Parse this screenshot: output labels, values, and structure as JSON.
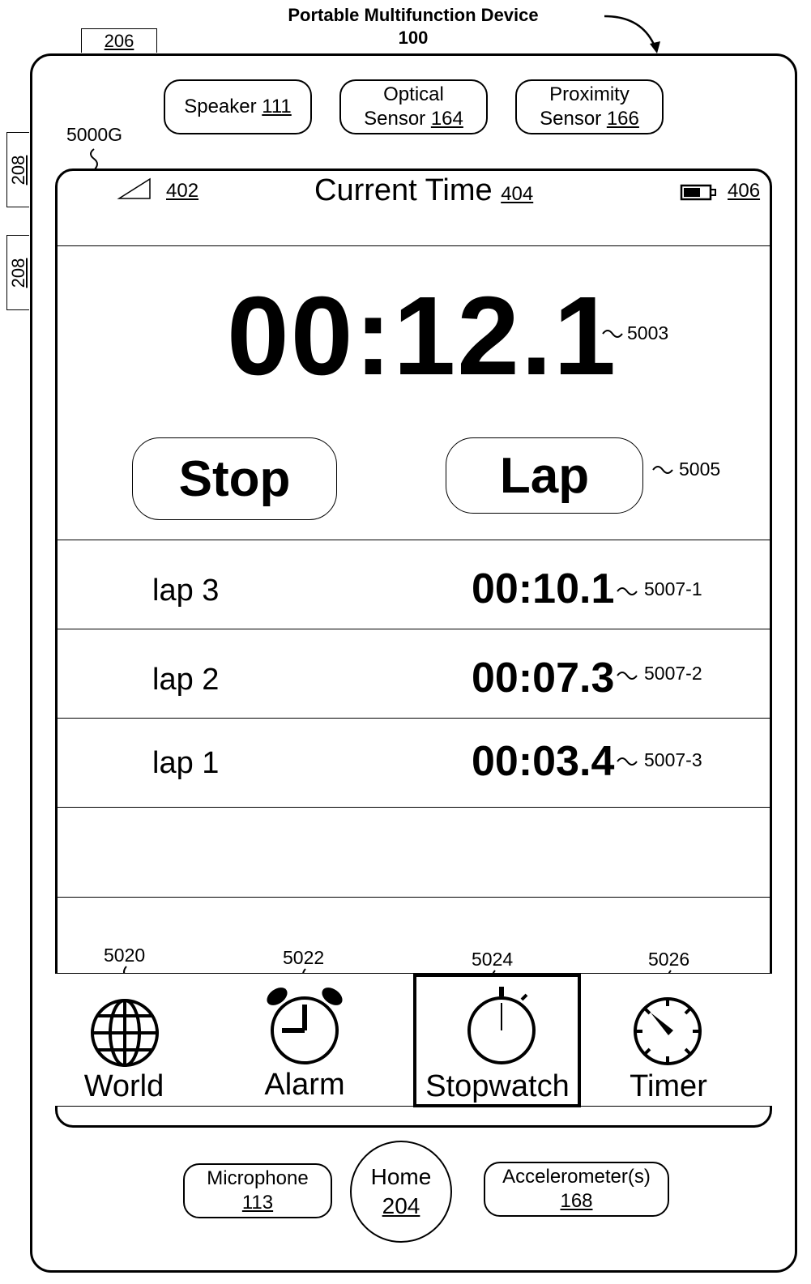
{
  "figure": {
    "title_line1": "Portable Multifunction Device",
    "title_line2": "100",
    "ref_206": "206",
    "ref_208_a": "208",
    "ref_208_b": "208",
    "screen_ref": "5000G"
  },
  "sensors": {
    "speaker_label": "Speaker",
    "speaker_ref": "111",
    "optical_label": "Optical",
    "optical_label2": "Sensor",
    "optical_ref": "164",
    "proximity_label": "Proximity",
    "proximity_label2": "Sensor",
    "proximity_ref": "166"
  },
  "status_bar": {
    "signal_ref": "402",
    "time_label": "Current Time",
    "time_ref": "404",
    "battery_ref": "406"
  },
  "stopwatch": {
    "elapsed": "00:12.1",
    "elapsed_ref": "5003",
    "stop_label": "Stop",
    "lap_label": "Lap",
    "buttons_ref": "5005",
    "laps": [
      {
        "name": "lap 3",
        "time": "00:10.1",
        "ref": "5007-1"
      },
      {
        "name": "lap 2",
        "time": "00:07.3",
        "ref": "5007-2"
      },
      {
        "name": "lap 1",
        "time": "00:03.4",
        "ref": "5007-3"
      }
    ]
  },
  "tabs": [
    {
      "label": "World",
      "ref": "5020",
      "icon": "globe-icon"
    },
    {
      "label": "Alarm",
      "ref": "5022",
      "icon": "alarm-clock-icon"
    },
    {
      "label": "Stopwatch",
      "ref": "5024",
      "icon": "stopwatch-icon",
      "selected": true
    },
    {
      "label": "Timer",
      "ref": "5026",
      "icon": "timer-icon"
    }
  ],
  "hardware": {
    "microphone_label": "Microphone",
    "microphone_ref": "113",
    "home_label": "Home",
    "home_ref": "204",
    "accelerometer_label": "Accelerometer(s)",
    "accelerometer_ref": "168"
  }
}
